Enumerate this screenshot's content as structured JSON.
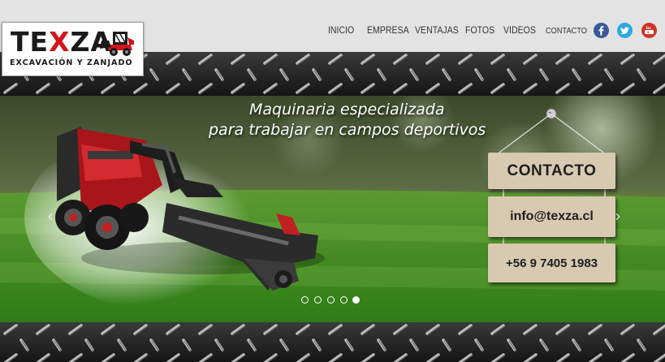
{
  "brand": {
    "logo_part1": "TE",
    "logo_part2": "X",
    "logo_part3": "ZA",
    "tagline": "EXCAVACIÓN Y ZANJADO"
  },
  "nav": {
    "items": [
      "INICIO",
      "EMPRESA",
      "VENTAJAS",
      "FOTOS",
      "VIDEOS",
      "CONTACTO"
    ]
  },
  "social": [
    {
      "icon": "facebook-icon",
      "color": "#3b5998"
    },
    {
      "icon": "twitter-icon",
      "color": "#2aa9e0"
    },
    {
      "icon": "youtube-icon",
      "color": "#cf3427"
    }
  ],
  "slider": {
    "headline_line1": "Maquinaria especializada",
    "headline_line2": "para trabajar en campos deportivos",
    "sign_title": "CONTACTO",
    "sign_email": "info@texza.cl",
    "sign_phone": "+56 9 7405 1983",
    "slide_count": 5,
    "active_slide": 5
  },
  "colors": {
    "brand_red": "#d3161b",
    "nav_text": "#333333",
    "header_bg": "#e3e3e3",
    "sign_wood": "#d8cab0"
  }
}
